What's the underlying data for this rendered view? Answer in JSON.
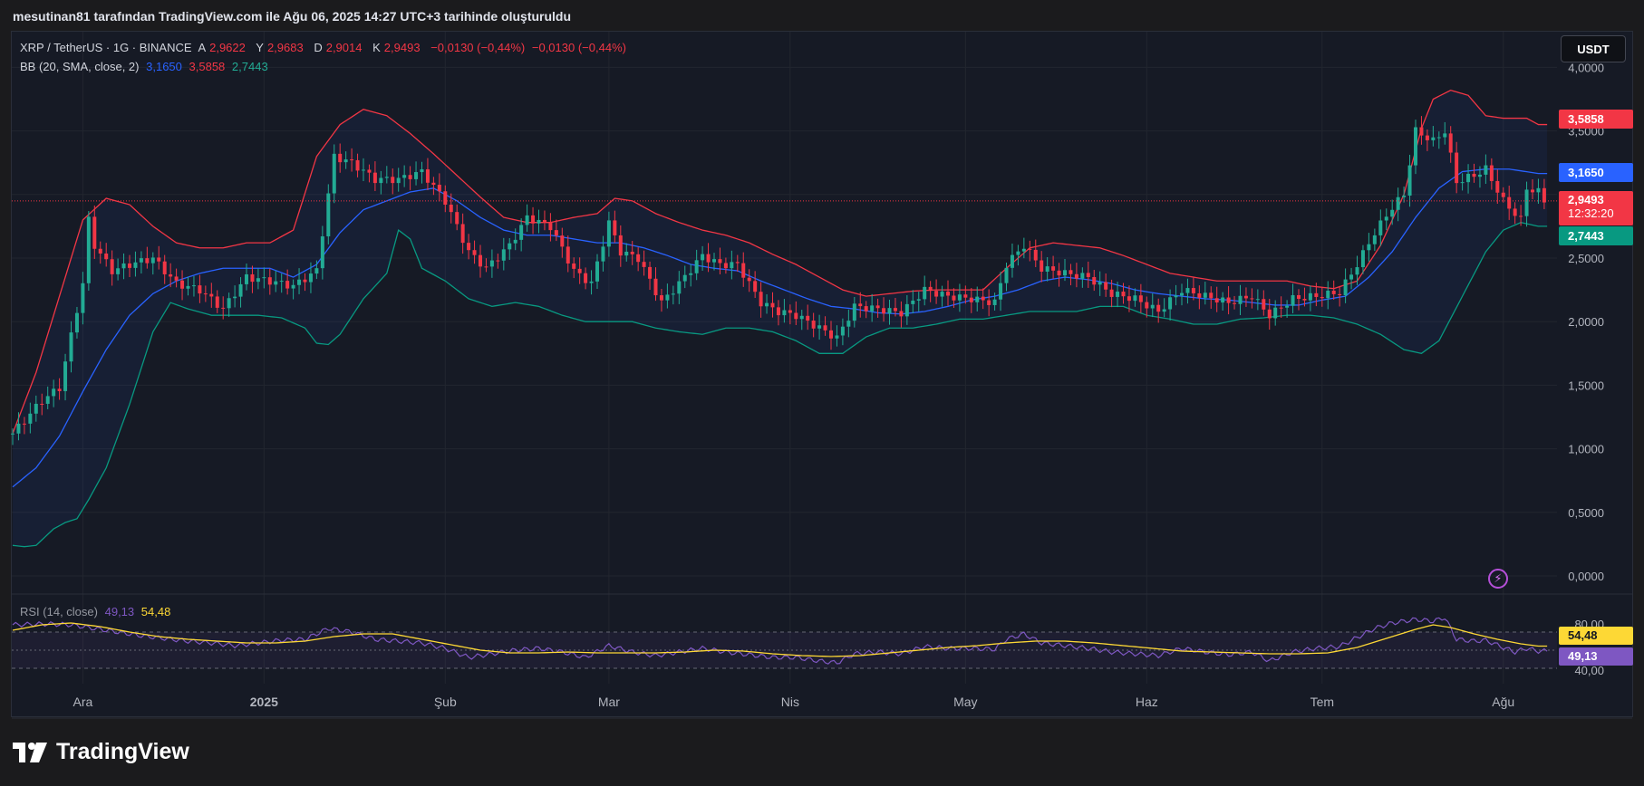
{
  "header": {
    "caption": "mesutinan81 tarafından TradingView.com ile Ağu 06, 2025 14:27 UTC+3 tarihinde oluşturuldu"
  },
  "legend": {
    "symbol": "XRP / TetherUS · 1G · BINANCE",
    "open_label": "A",
    "open": "2,9622",
    "high_label": "Y",
    "high": "2,9683",
    "low_label": "D",
    "low": "2,9014",
    "close_label": "K",
    "close": "2,9493",
    "change1": "−0,0130 (−0,44%)",
    "change2": "−0,0130 (−0,44%)",
    "bb_label": "BB (20, SMA, close, 2)",
    "bb_basis": "3,1650",
    "bb_upper": "3,5858",
    "bb_lower": "2,7443",
    "rsi_label": "RSI (14, close)",
    "rsi_value": "49,13",
    "rsi_ma": "54,48"
  },
  "currency_button": "USDT",
  "price_tags": {
    "upper": "3,5858",
    "basis": "3,1650",
    "last": "2,9493",
    "countdown": "12:32:20",
    "lower": "2,7443",
    "rsi_ma": "54,48",
    "rsi": "49,13"
  },
  "footer": {
    "brand": "TradingView"
  },
  "colors": {
    "up": "#22ab94",
    "down": "#f23645",
    "basis": "#2962ff",
    "rsi": "#7e57c2",
    "rsi_ma": "#fdd835"
  },
  "icons": {
    "flash": "flash-icon",
    "logo": "tradingview-logo-icon"
  },
  "chart_data": {
    "type": "candlestick",
    "title": "XRP / TetherUS · 1G · BINANCE",
    "price_axis": {
      "min": 0,
      "max": 4.0,
      "ticks": [
        "0,0000",
        "0,5000",
        "1,0000",
        "1,5000",
        "2,0000",
        "2,5000",
        "3,0000",
        "3,5000",
        "4,0000"
      ]
    },
    "x_tick_labels": [
      "Ara",
      "2025",
      "Şub",
      "Mar",
      "Nis",
      "May",
      "Haz",
      "Tem",
      "Ağu"
    ],
    "x_tick_days": [
      12,
      43,
      74,
      102,
      133,
      163,
      194,
      224,
      255
    ],
    "price_keypoints": [
      [
        0,
        1.12
      ],
      [
        5,
        1.38
      ],
      [
        8,
        1.48
      ],
      [
        12,
        2.3
      ],
      [
        13,
        2.8
      ],
      [
        14,
        2.6
      ],
      [
        17,
        2.4
      ],
      [
        20,
        2.45
      ],
      [
        24,
        2.5
      ],
      [
        28,
        2.3
      ],
      [
        32,
        2.25
      ],
      [
        36,
        2.1
      ],
      [
        40,
        2.35
      ],
      [
        44,
        2.32
      ],
      [
        48,
        2.28
      ],
      [
        52,
        2.4
      ],
      [
        55,
        3.3
      ],
      [
        58,
        3.25
      ],
      [
        62,
        3.12
      ],
      [
        66,
        3.12
      ],
      [
        70,
        3.18
      ],
      [
        74,
        2.95
      ],
      [
        78,
        2.55
      ],
      [
        81,
        2.42
      ],
      [
        85,
        2.6
      ],
      [
        88,
        2.82
      ],
      [
        92,
        2.75
      ],
      [
        96,
        2.4
      ],
      [
        99,
        2.3
      ],
      [
        102,
        2.78
      ],
      [
        104,
        2.55
      ],
      [
        107,
        2.5
      ],
      [
        111,
        2.15
      ],
      [
        114,
        2.3
      ],
      [
        118,
        2.52
      ],
      [
        121,
        2.45
      ],
      [
        124,
        2.45
      ],
      [
        128,
        2.15
      ],
      [
        131,
        2.08
      ],
      [
        134,
        2.05
      ],
      [
        138,
        1.95
      ],
      [
        141,
        1.87
      ],
      [
        144,
        2.12
      ],
      [
        148,
        2.1
      ],
      [
        152,
        2.07
      ],
      [
        156,
        2.25
      ],
      [
        160,
        2.2
      ],
      [
        164,
        2.18
      ],
      [
        168,
        2.15
      ],
      [
        170,
        2.45
      ],
      [
        173,
        2.6
      ],
      [
        176,
        2.42
      ],
      [
        180,
        2.38
      ],
      [
        184,
        2.35
      ],
      [
        188,
        2.22
      ],
      [
        192,
        2.18
      ],
      [
        196,
        2.08
      ],
      [
        200,
        2.25
      ],
      [
        204,
        2.2
      ],
      [
        208,
        2.15
      ],
      [
        212,
        2.2
      ],
      [
        215,
        2.05
      ],
      [
        219,
        2.18
      ],
      [
        223,
        2.2
      ],
      [
        227,
        2.23
      ],
      [
        230,
        2.45
      ],
      [
        233,
        2.7
      ],
      [
        236,
        2.9
      ],
      [
        238,
        3.0
      ],
      [
        240,
        3.5
      ],
      [
        243,
        3.42
      ],
      [
        245,
        3.5
      ],
      [
        247,
        3.1
      ],
      [
        250,
        3.15
      ],
      [
        252,
        3.2
      ],
      [
        255,
        2.95
      ],
      [
        257,
        2.85
      ],
      [
        258,
        2.8
      ],
      [
        259,
        3.05
      ],
      [
        261,
        3.02
      ],
      [
        262,
        2.95
      ]
    ],
    "bb_upper_keypoints": [
      [
        0,
        1.12
      ],
      [
        4,
        1.6
      ],
      [
        8,
        2.2
      ],
      [
        12,
        2.8
      ],
      [
        16,
        2.97
      ],
      [
        20,
        2.92
      ],
      [
        24,
        2.75
      ],
      [
        28,
        2.62
      ],
      [
        32,
        2.58
      ],
      [
        36,
        2.58
      ],
      [
        40,
        2.62
      ],
      [
        44,
        2.62
      ],
      [
        48,
        2.72
      ],
      [
        52,
        3.3
      ],
      [
        56,
        3.55
      ],
      [
        60,
        3.67
      ],
      [
        64,
        3.62
      ],
      [
        68,
        3.48
      ],
      [
        72,
        3.32
      ],
      [
        76,
        3.15
      ],
      [
        80,
        2.98
      ],
      [
        84,
        2.82
      ],
      [
        88,
        2.78
      ],
      [
        92,
        2.78
      ],
      [
        96,
        2.82
      ],
      [
        100,
        2.85
      ],
      [
        103,
        2.97
      ],
      [
        106,
        2.95
      ],
      [
        110,
        2.85
      ],
      [
        114,
        2.78
      ],
      [
        118,
        2.72
      ],
      [
        122,
        2.68
      ],
      [
        126,
        2.62
      ],
      [
        130,
        2.53
      ],
      [
        134,
        2.45
      ],
      [
        138,
        2.35
      ],
      [
        142,
        2.25
      ],
      [
        146,
        2.2
      ],
      [
        150,
        2.22
      ],
      [
        154,
        2.24
      ],
      [
        158,
        2.25
      ],
      [
        162,
        2.25
      ],
      [
        166,
        2.25
      ],
      [
        170,
        2.42
      ],
      [
        174,
        2.58
      ],
      [
        178,
        2.62
      ],
      [
        182,
        2.6
      ],
      [
        186,
        2.58
      ],
      [
        190,
        2.52
      ],
      [
        194,
        2.45
      ],
      [
        198,
        2.38
      ],
      [
        202,
        2.35
      ],
      [
        206,
        2.32
      ],
      [
        210,
        2.32
      ],
      [
        214,
        2.32
      ],
      [
        218,
        2.32
      ],
      [
        222,
        2.28
      ],
      [
        226,
        2.26
      ],
      [
        230,
        2.32
      ],
      [
        234,
        2.6
      ],
      [
        238,
        3.0
      ],
      [
        241,
        3.52
      ],
      [
        243,
        3.75
      ],
      [
        246,
        3.82
      ],
      [
        249,
        3.78
      ],
      [
        252,
        3.62
      ],
      [
        255,
        3.6
      ],
      [
        259,
        3.6
      ],
      [
        261,
        3.55
      ]
    ],
    "bb_basis_keypoints": [
      [
        0,
        0.7
      ],
      [
        4,
        0.85
      ],
      [
        8,
        1.1
      ],
      [
        12,
        1.45
      ],
      [
        16,
        1.78
      ],
      [
        20,
        2.05
      ],
      [
        24,
        2.22
      ],
      [
        28,
        2.32
      ],
      [
        32,
        2.38
      ],
      [
        36,
        2.42
      ],
      [
        40,
        2.42
      ],
      [
        44,
        2.42
      ],
      [
        48,
        2.35
      ],
      [
        52,
        2.45
      ],
      [
        56,
        2.7
      ],
      [
        60,
        2.88
      ],
      [
        64,
        2.95
      ],
      [
        68,
        3.02
      ],
      [
        72,
        3.05
      ],
      [
        76,
        2.95
      ],
      [
        80,
        2.82
      ],
      [
        84,
        2.72
      ],
      [
        88,
        2.68
      ],
      [
        92,
        2.68
      ],
      [
        96,
        2.65
      ],
      [
        100,
        2.62
      ],
      [
        104,
        2.62
      ],
      [
        108,
        2.58
      ],
      [
        112,
        2.52
      ],
      [
        116,
        2.45
      ],
      [
        120,
        2.42
      ],
      [
        124,
        2.4
      ],
      [
        128,
        2.32
      ],
      [
        132,
        2.25
      ],
      [
        136,
        2.18
      ],
      [
        140,
        2.12
      ],
      [
        144,
        2.1
      ],
      [
        148,
        2.07
      ],
      [
        152,
        2.06
      ],
      [
        156,
        2.08
      ],
      [
        160,
        2.12
      ],
      [
        164,
        2.17
      ],
      [
        168,
        2.2
      ],
      [
        172,
        2.25
      ],
      [
        176,
        2.32
      ],
      [
        180,
        2.35
      ],
      [
        184,
        2.33
      ],
      [
        188,
        2.3
      ],
      [
        192,
        2.25
      ],
      [
        196,
        2.22
      ],
      [
        200,
        2.2
      ],
      [
        204,
        2.18
      ],
      [
        208,
        2.17
      ],
      [
        212,
        2.15
      ],
      [
        216,
        2.13
      ],
      [
        220,
        2.13
      ],
      [
        224,
        2.17
      ],
      [
        228,
        2.2
      ],
      [
        232,
        2.35
      ],
      [
        236,
        2.55
      ],
      [
        240,
        2.82
      ],
      [
        244,
        3.05
      ],
      [
        248,
        3.18
      ],
      [
        252,
        3.2
      ],
      [
        256,
        3.2
      ],
      [
        261,
        3.165
      ]
    ],
    "bb_lower_keypoints": [
      [
        0,
        0.24
      ],
      [
        2,
        0.23
      ],
      [
        4,
        0.24
      ],
      [
        7,
        0.37
      ],
      [
        9,
        0.42
      ],
      [
        11,
        0.45
      ],
      [
        13,
        0.6
      ],
      [
        16,
        0.85
      ],
      [
        20,
        1.35
      ],
      [
        24,
        1.92
      ],
      [
        27,
        2.15
      ],
      [
        30,
        2.1
      ],
      [
        34,
        2.05
      ],
      [
        38,
        2.05
      ],
      [
        42,
        2.05
      ],
      [
        46,
        2.03
      ],
      [
        50,
        1.95
      ],
      [
        52,
        1.83
      ],
      [
        54,
        1.82
      ],
      [
        56,
        1.9
      ],
      [
        60,
        2.18
      ],
      [
        64,
        2.38
      ],
      [
        66,
        2.72
      ],
      [
        68,
        2.65
      ],
      [
        70,
        2.42
      ],
      [
        74,
        2.32
      ],
      [
        78,
        2.18
      ],
      [
        82,
        2.12
      ],
      [
        86,
        2.15
      ],
      [
        90,
        2.12
      ],
      [
        94,
        2.05
      ],
      [
        98,
        2.0
      ],
      [
        102,
        2.0
      ],
      [
        106,
        2.0
      ],
      [
        110,
        1.95
      ],
      [
        114,
        1.92
      ],
      [
        118,
        1.9
      ],
      [
        122,
        1.95
      ],
      [
        126,
        1.95
      ],
      [
        130,
        1.92
      ],
      [
        134,
        1.85
      ],
      [
        138,
        1.75
      ],
      [
        142,
        1.75
      ],
      [
        146,
        1.88
      ],
      [
        150,
        1.95
      ],
      [
        154,
        1.95
      ],
      [
        158,
        1.98
      ],
      [
        162,
        2.02
      ],
      [
        166,
        2.02
      ],
      [
        170,
        2.05
      ],
      [
        174,
        2.08
      ],
      [
        178,
        2.08
      ],
      [
        182,
        2.08
      ],
      [
        186,
        2.12
      ],
      [
        190,
        2.12
      ],
      [
        194,
        2.05
      ],
      [
        198,
        2.02
      ],
      [
        202,
        1.98
      ],
      [
        206,
        1.98
      ],
      [
        210,
        2.02
      ],
      [
        214,
        2.03
      ],
      [
        218,
        2.05
      ],
      [
        222,
        2.05
      ],
      [
        226,
        2.03
      ],
      [
        230,
        1.98
      ],
      [
        234,
        1.9
      ],
      [
        238,
        1.78
      ],
      [
        241,
        1.75
      ],
      [
        244,
        1.85
      ],
      [
        248,
        2.2
      ],
      [
        252,
        2.55
      ],
      [
        255,
        2.72
      ],
      [
        258,
        2.78
      ],
      [
        261,
        2.75
      ]
    ],
    "rsi_axis": {
      "labels": [
        "80,00",
        "40,00"
      ]
    },
    "rsi_keypoints": [
      [
        0,
        78
      ],
      [
        6,
        79
      ],
      [
        10,
        78
      ],
      [
        14,
        74
      ],
      [
        18,
        70
      ],
      [
        22,
        66
      ],
      [
        26,
        63
      ],
      [
        30,
        60
      ],
      [
        34,
        58
      ],
      [
        38,
        55
      ],
      [
        42,
        58
      ],
      [
        46,
        61
      ],
      [
        50,
        62
      ],
      [
        54,
        74
      ],
      [
        58,
        70
      ],
      [
        62,
        62
      ],
      [
        66,
        60
      ],
      [
        70,
        58
      ],
      [
        74,
        52
      ],
      [
        78,
        42
      ],
      [
        82,
        46
      ],
      [
        86,
        50
      ],
      [
        90,
        52
      ],
      [
        94,
        48
      ],
      [
        98,
        42
      ],
      [
        102,
        55
      ],
      [
        106,
        48
      ],
      [
        110,
        44
      ],
      [
        114,
        48
      ],
      [
        118,
        52
      ],
      [
        122,
        48
      ],
      [
        126,
        45
      ],
      [
        130,
        42
      ],
      [
        134,
        42
      ],
      [
        138,
        38
      ],
      [
        141,
        36
      ],
      [
        144,
        46
      ],
      [
        148,
        48
      ],
      [
        152,
        46
      ],
      [
        156,
        54
      ],
      [
        160,
        52
      ],
      [
        164,
        52
      ],
      [
        168,
        51
      ],
      [
        170,
        62
      ],
      [
        173,
        68
      ],
      [
        176,
        58
      ],
      [
        180,
        55
      ],
      [
        184,
        52
      ],
      [
        188,
        48
      ],
      [
        192,
        46
      ],
      [
        196,
        44
      ],
      [
        200,
        52
      ],
      [
        204,
        48
      ],
      [
        208,
        45
      ],
      [
        212,
        48
      ],
      [
        215,
        38
      ],
      [
        219,
        48
      ],
      [
        223,
        52
      ],
      [
        227,
        54
      ],
      [
        230,
        64
      ],
      [
        233,
        74
      ],
      [
        236,
        80
      ],
      [
        240,
        84
      ],
      [
        243,
        82
      ],
      [
        245,
        86
      ],
      [
        247,
        62
      ],
      [
        250,
        60
      ],
      [
        252,
        61
      ],
      [
        255,
        53
      ],
      [
        257,
        48
      ],
      [
        259,
        52
      ],
      [
        261,
        49
      ]
    ],
    "rsi_ma_keypoints": [
      [
        0,
        72
      ],
      [
        5,
        78
      ],
      [
        10,
        80
      ],
      [
        15,
        76
      ],
      [
        20,
        70
      ],
      [
        25,
        65
      ],
      [
        30,
        62
      ],
      [
        35,
        60
      ],
      [
        40,
        58
      ],
      [
        45,
        58
      ],
      [
        50,
        60
      ],
      [
        55,
        65
      ],
      [
        60,
        68
      ],
      [
        65,
        68
      ],
      [
        70,
        62
      ],
      [
        75,
        56
      ],
      [
        80,
        50
      ],
      [
        85,
        47
      ],
      [
        90,
        47
      ],
      [
        95,
        48
      ],
      [
        100,
        47
      ],
      [
        105,
        47
      ],
      [
        110,
        47
      ],
      [
        115,
        48
      ],
      [
        120,
        50
      ],
      [
        125,
        49
      ],
      [
        130,
        46
      ],
      [
        135,
        44
      ],
      [
        140,
        43
      ],
      [
        145,
        44
      ],
      [
        150,
        47
      ],
      [
        155,
        50
      ],
      [
        160,
        53
      ],
      [
        165,
        55
      ],
      [
        170,
        58
      ],
      [
        175,
        60
      ],
      [
        180,
        60
      ],
      [
        185,
        58
      ],
      [
        190,
        55
      ],
      [
        195,
        52
      ],
      [
        200,
        49
      ],
      [
        205,
        48
      ],
      [
        210,
        47
      ],
      [
        215,
        46
      ],
      [
        220,
        46
      ],
      [
        225,
        47
      ],
      [
        230,
        53
      ],
      [
        235,
        63
      ],
      [
        240,
        73
      ],
      [
        243,
        78
      ],
      [
        246,
        75
      ],
      [
        250,
        68
      ],
      [
        254,
        62
      ],
      [
        258,
        57
      ],
      [
        261,
        54.5
      ]
    ]
  }
}
